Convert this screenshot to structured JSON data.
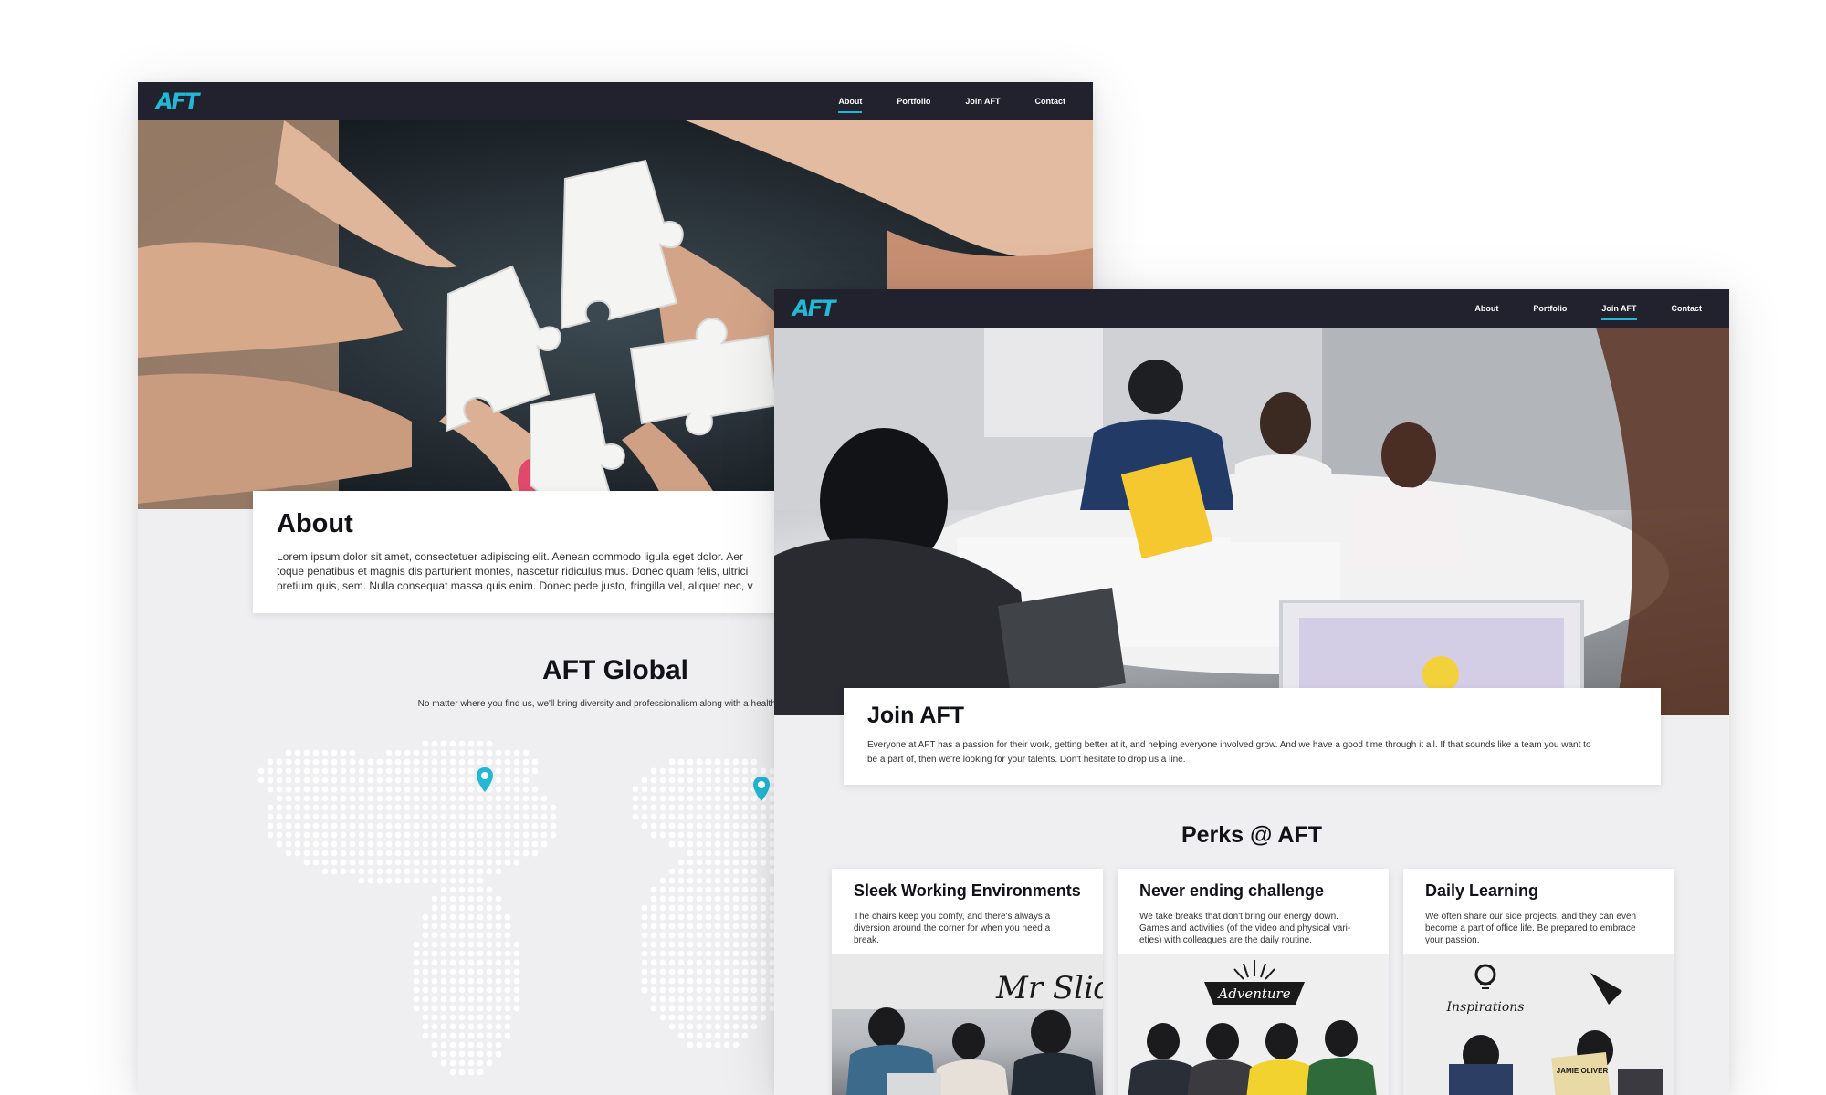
{
  "colors": {
    "accent": "#22b8d6",
    "nav_bg": "#22222f",
    "page_bg": "#efeff1",
    "dot": "#ffffff"
  },
  "brand": {
    "logo_text": "AFT"
  },
  "nav": {
    "items": [
      {
        "label": "About"
      },
      {
        "label": "Portfolio"
      },
      {
        "label": "Join AFT"
      },
      {
        "label": "Contact"
      }
    ]
  },
  "about_page": {
    "active_nav": "About",
    "hero_image": "hands-with-puzzle-pieces",
    "about": {
      "title": "About",
      "lines": [
        "Lorem ipsum dolor sit amet, consectetuer adipiscing elit. Aenean commodo ligula eget dolor. Aer",
        "toque penatibus et magnis dis parturient montes, nascetur ridiculus mus. Donec quam felis, ultrici",
        "pretium quis, sem. Nulla consequat massa quis enim. Donec pede justo, fringilla vel, aliquet nec, v"
      ]
    },
    "global": {
      "title": "AFT Global",
      "subtitle": "No matter where you find us, we'll bring diversity and professionalism along with a healthy dose of",
      "map_icon": "location-pin-icon"
    }
  },
  "join_page": {
    "active_nav": "Join AFT",
    "hero_image": "team-meeting-at-table",
    "join": {
      "title": "Join AFT",
      "lines": [
        "Everyone at AFT has a passion for their work, getting better at it, and helping everyone involved grow. And we have a good time through it all. If that sounds like a team you want to",
        "be a part of, then we're looking for your talents. Don't hesitate to drop us a line."
      ]
    },
    "perks": {
      "title": "Perks @ AFT",
      "items": [
        {
          "title": "Sleek Working Environments",
          "lines": [
            "The chairs keep you comfy, and there's always a",
            "diversion around the corner for when you need a",
            "break."
          ],
          "photo": "team-lounge-photo",
          "wall_text": "Mr Slide"
        },
        {
          "title": "Never ending challenge",
          "lines": [
            "We take breaks that don't bring our energy down.",
            "Games and activities (of the video and physical vari-",
            "eties) with colleagues are the daily routine."
          ],
          "photo": "team-gaming-photo",
          "wall_text": "Adventure"
        },
        {
          "title": "Daily Learning",
          "lines": [
            "We often share our side projects, and they can even",
            "become a part of office life. Be prepared to embrace",
            "your passion."
          ],
          "photo": "team-reading-photo",
          "wall_text": "Inspirations",
          "book_text": "JAMIE OLIVER"
        }
      ]
    }
  }
}
